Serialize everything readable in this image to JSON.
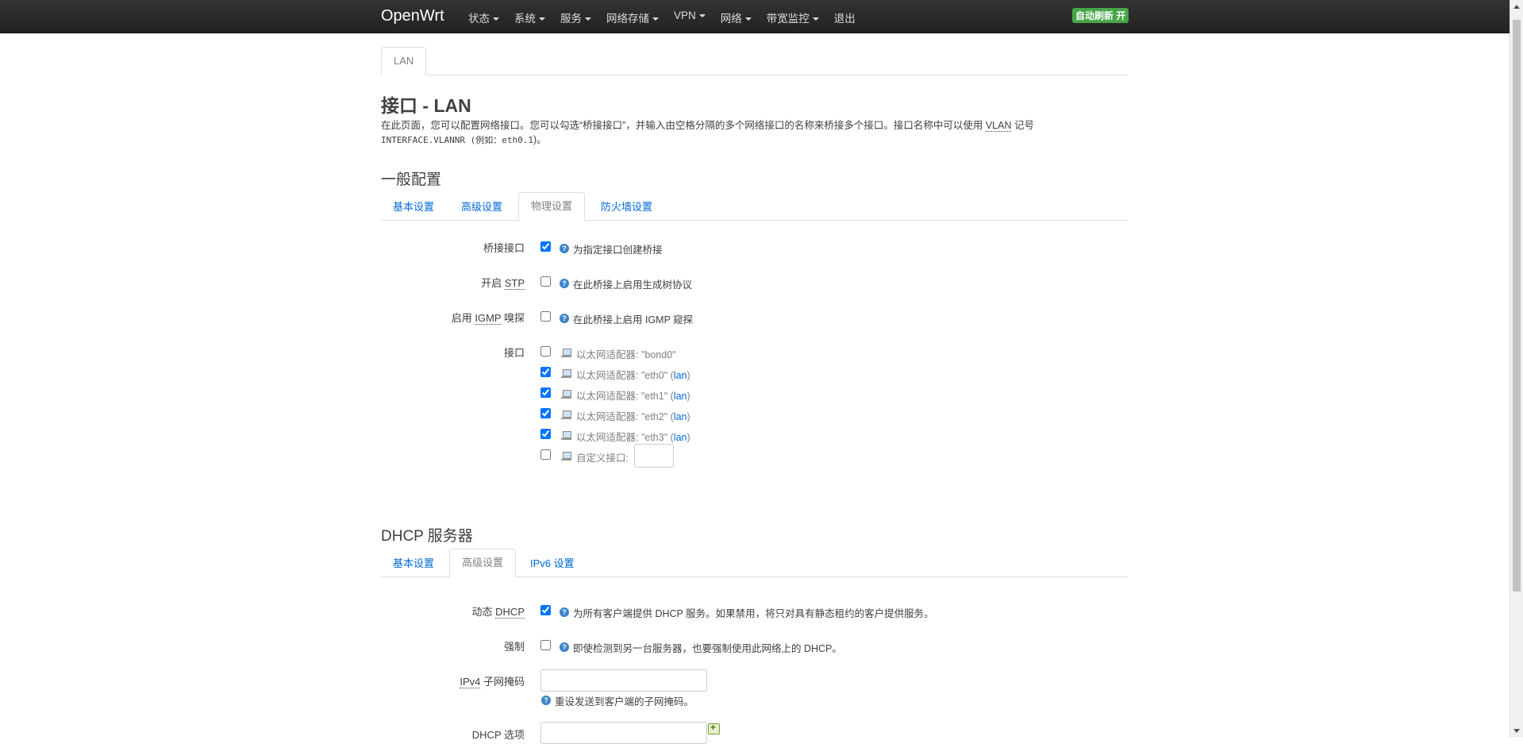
{
  "nav": {
    "brand": "OpenWrt",
    "menu": [
      "状态",
      "系统",
      "服务",
      "网络存储",
      "VPN",
      "网络",
      "带宽监控"
    ],
    "logout": "退出",
    "auto_refresh": "自动刷新 开"
  },
  "top_tab": "LAN",
  "page": {
    "title": "接口 - LAN",
    "desc_prefix": "在此页面，您可以配置网络接口。您可以勾选“桥接接口”，并输入由空格分隔的多个网络接口的名称来桥接多个接口。接口名称中可以使用 ",
    "desc_vlan": "VLAN",
    "desc_suffix": " 记号",
    "desc_code": "INTERFACE.VLANNR",
    "desc_example": " (例如：",
    "desc_example_code": "eth0.1",
    "desc_end": ")。"
  },
  "general": {
    "heading": "一般配置",
    "tabs": [
      "基本设置",
      "高级设置",
      "物理设置",
      "防火墙设置"
    ],
    "bridge": {
      "label": "桥接接口",
      "help": "为指定接口创建桥接",
      "checked": true
    },
    "stp": {
      "label_pre": "开启 ",
      "label_abbr": "STP",
      "help": "在此桥接上启用生成树协议",
      "checked": false
    },
    "igmp": {
      "label_pre": "启用 ",
      "label_abbr": "IGMP",
      "label_post": " 嗅探",
      "help": "在此桥接上启用 IGMP 窥探",
      "checked": false
    },
    "iface": {
      "label": "接口",
      "items": [
        {
          "text": "以太网适配器: \"bond0\"",
          "net": "",
          "checked": false
        },
        {
          "text": "以太网适配器: \"eth0\" (",
          "net": "lan",
          "checked": true
        },
        {
          "text": "以太网适配器: \"eth1\" (",
          "net": "lan",
          "checked": true
        },
        {
          "text": "以太网适配器: \"eth2\" (",
          "net": "lan",
          "checked": true
        },
        {
          "text": "以太网适配器: \"eth3\" (",
          "net": "lan",
          "checked": true
        }
      ],
      "custom_label": "自定义接口:",
      "custom_value": ""
    }
  },
  "dhcp": {
    "heading": "DHCP 服务器",
    "tabs": [
      "基本设置",
      "高级设置",
      "IPv6 设置"
    ],
    "dynamic": {
      "label_pre": "动态 ",
      "label_abbr": "DHCP",
      "help": "为所有客户端提供 DHCP 服务。如果禁用，将只对具有静态租约的客户提供服务。",
      "checked": true
    },
    "force": {
      "label": "强制",
      "help": "即使检测到另一台服务器，也要强制使用此网络上的 DHCP。",
      "checked": false
    },
    "netmask": {
      "label_abbr": "IPv4",
      "label_post": " 子网掩码",
      "value": "",
      "help": "重设发送到客户端的子网掩码。"
    },
    "options": {
      "label": "DHCP 选项",
      "value": ""
    }
  }
}
